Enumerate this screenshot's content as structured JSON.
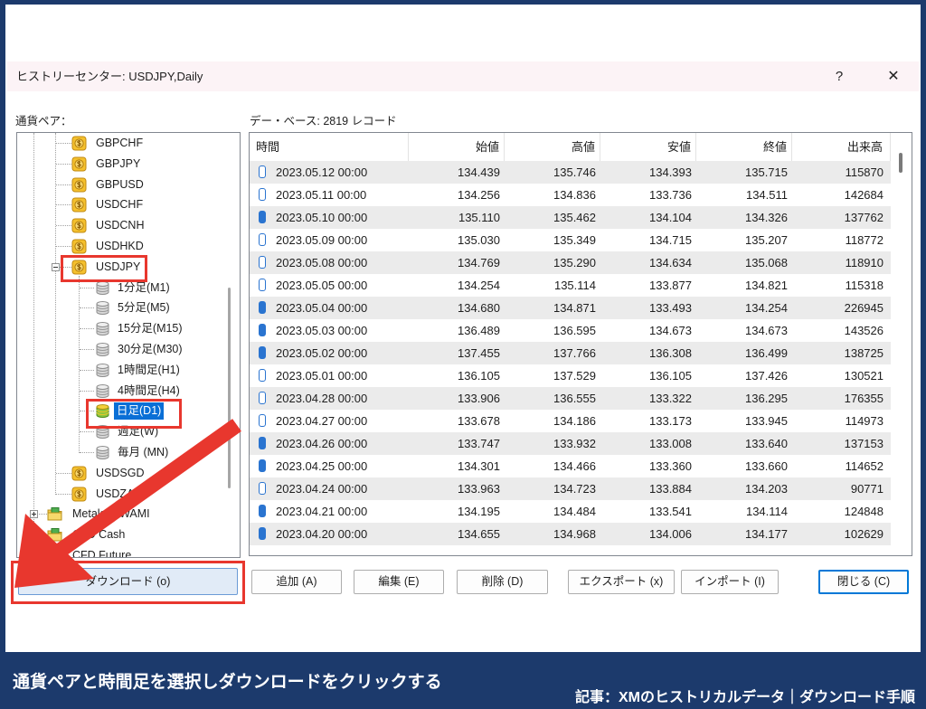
{
  "window": {
    "title": "ヒストリーセンター: USDJPY,Daily",
    "help_label": "?",
    "close_label": "✕"
  },
  "symbols_panel": {
    "label": "通貨ペア：",
    "tree": [
      {
        "label": "GBPCHF",
        "level": 1,
        "icon": "coin-icon"
      },
      {
        "label": "GBPJPY",
        "level": 1,
        "icon": "coin-icon"
      },
      {
        "label": "GBPUSD",
        "level": 1,
        "icon": "coin-icon"
      },
      {
        "label": "USDCHF",
        "level": 1,
        "icon": "coin-icon"
      },
      {
        "label": "USDCNH",
        "level": 1,
        "icon": "coin-icon"
      },
      {
        "label": "USDHKD",
        "level": 1,
        "icon": "coin-icon"
      },
      {
        "label": "USDJPY",
        "level": 1,
        "icon": "coin-icon",
        "expander": "collapse"
      },
      {
        "label": "1分足(M1)",
        "level": 2,
        "icon": "database-icon"
      },
      {
        "label": "5分足(M5)",
        "level": 2,
        "icon": "database-icon"
      },
      {
        "label": "15分足(M15)",
        "level": 2,
        "icon": "database-icon"
      },
      {
        "label": "30分足(M30)",
        "level": 2,
        "icon": "database-icon"
      },
      {
        "label": "1時間足(H1)",
        "level": 2,
        "icon": "database-icon"
      },
      {
        "label": "4時間足(H4)",
        "level": 2,
        "icon": "database-icon"
      },
      {
        "label": "日足(D1)",
        "level": 2,
        "icon": "database-active-icon",
        "selected": true
      },
      {
        "label": "週足(W)",
        "level": 2,
        "icon": "database-icon"
      },
      {
        "label": "毎月 (MN)",
        "level": 2,
        "icon": "database-icon"
      },
      {
        "label": "USDSGD",
        "level": 1,
        "icon": "coin-icon"
      },
      {
        "label": "USDZAR",
        "level": 1,
        "icon": "coin-icon"
      },
      {
        "label": "Metals KIWAMI",
        "level": 0,
        "icon": "folder-icon",
        "expander": "expand"
      },
      {
        "label": "CFD Cash",
        "level": 0,
        "icon": "folder-icon",
        "expander": "expand"
      },
      {
        "label": "CFD Future",
        "level": 0,
        "icon": "folder-icon",
        "expander": "expand"
      }
    ]
  },
  "database_panel": {
    "label": "デー・ベース: 2819 レコード",
    "columns": [
      "時間",
      "始値",
      "高値",
      "安値",
      "終値",
      "出来高"
    ],
    "rows": [
      [
        "2023.05.12 00:00",
        "134.439",
        "135.746",
        "134.393",
        "135.715",
        "115870"
      ],
      [
        "2023.05.11 00:00",
        "134.256",
        "134.836",
        "133.736",
        "134.511",
        "142684"
      ],
      [
        "2023.05.10 00:00",
        "135.110",
        "135.462",
        "134.104",
        "134.326",
        "137762"
      ],
      [
        "2023.05.09 00:00",
        "135.030",
        "135.349",
        "134.715",
        "135.207",
        "118772"
      ],
      [
        "2023.05.08 00:00",
        "134.769",
        "135.290",
        "134.634",
        "135.068",
        "118910"
      ],
      [
        "2023.05.05 00:00",
        "134.254",
        "135.114",
        "133.877",
        "134.821",
        "115318"
      ],
      [
        "2023.05.04 00:00",
        "134.680",
        "134.871",
        "133.493",
        "134.254",
        "226945"
      ],
      [
        "2023.05.03 00:00",
        "136.489",
        "136.595",
        "134.673",
        "134.673",
        "143526"
      ],
      [
        "2023.05.02 00:00",
        "137.455",
        "137.766",
        "136.308",
        "136.499",
        "138725"
      ],
      [
        "2023.05.01 00:00",
        "136.105",
        "137.529",
        "136.105",
        "137.426",
        "130521"
      ],
      [
        "2023.04.28 00:00",
        "133.906",
        "136.555",
        "133.322",
        "136.295",
        "176355"
      ],
      [
        "2023.04.27 00:00",
        "133.678",
        "134.186",
        "133.173",
        "133.945",
        "114973"
      ],
      [
        "2023.04.26 00:00",
        "133.747",
        "133.932",
        "133.008",
        "133.640",
        "137153"
      ],
      [
        "2023.04.25 00:00",
        "134.301",
        "134.466",
        "133.360",
        "133.660",
        "114652"
      ],
      [
        "2023.04.24 00:00",
        "133.963",
        "134.723",
        "133.884",
        "134.203",
        "90771"
      ],
      [
        "2023.04.21 00:00",
        "134.195",
        "134.484",
        "133.541",
        "134.114",
        "124848"
      ],
      [
        "2023.04.20 00:00",
        "134.655",
        "134.968",
        "134.006",
        "134.177",
        "102629"
      ]
    ]
  },
  "actions": {
    "download": "ダウンロード (o)",
    "add": "追加 (A)",
    "edit": "編集 (E)",
    "delete": "削除 (D)",
    "export": "エクスポート (x)",
    "import": "インポート (I)",
    "close": "閉じる (C)"
  },
  "caption": {
    "text": "通貨ペアと時間足を選択しダウンロードをクリックする",
    "source": "記事：XMのヒストリカルデータ｜ダウンロード手順"
  },
  "colors": {
    "frame": "#1c3a6c",
    "annotation": "#e8372e",
    "selection": "#0a6fd6",
    "row_stripe": "#ebebeb",
    "bar": "#2a74d0",
    "focus": "#0078d7"
  }
}
